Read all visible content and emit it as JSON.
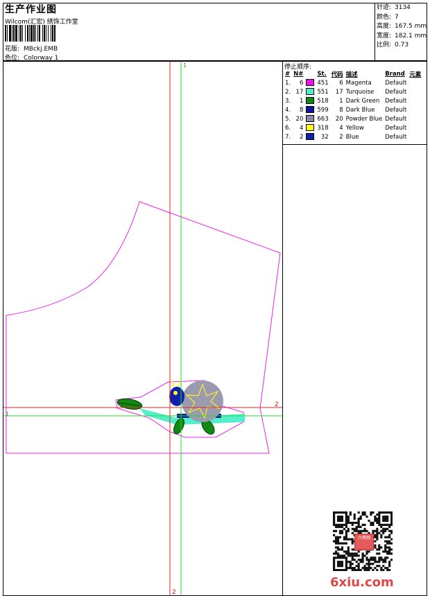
{
  "header": {
    "title": "生产作业图",
    "studio": "Wilcom(汇宏) 绣饰工作室",
    "design_label": "花版:",
    "design_value": "MBckj.EMB",
    "colorway_label": "色位:",
    "colorway_value": "Colorway 1"
  },
  "stats": [
    {
      "label": "针迹:",
      "value": "3134"
    },
    {
      "label": "颜色:",
      "value": "7"
    },
    {
      "label": "高度:",
      "value": "167.5 mm"
    },
    {
      "label": "宽度:",
      "value": "182.1 mm"
    },
    {
      "label": "比例:",
      "value": "0.73"
    }
  ],
  "canvas": {
    "marker_top": "1",
    "marker_left": "1",
    "marker_right": "2",
    "marker_bottom": "2"
  },
  "stop_sequence": {
    "title": "停止顺序:",
    "headers": [
      "#",
      "N#",
      "St.",
      "代码",
      "描述",
      "Brand",
      "元素"
    ],
    "rows": [
      {
        "idx": "1.",
        "n": "6",
        "color": "#ee11ee",
        "st": "451",
        "code": "6",
        "desc": "Magenta",
        "brand": "Default"
      },
      {
        "idx": "2.",
        "n": "17",
        "color": "#55eecc",
        "st": "551",
        "code": "17",
        "desc": "Turquoise",
        "brand": "Default"
      },
      {
        "idx": "3.",
        "n": "1",
        "color": "#118811",
        "st": "518",
        "code": "1",
        "desc": "Dark Green",
        "brand": "Default"
      },
      {
        "idx": "4.",
        "n": "8",
        "color": "#0a1a99",
        "st": "599",
        "code": "8",
        "desc": "Dark Blue",
        "brand": "Default"
      },
      {
        "idx": "5.",
        "n": "20",
        "color": "#8a8aa2",
        "st": "663",
        "code": "20",
        "desc": "Powder Blue",
        "brand": "Default"
      },
      {
        "idx": "6.",
        "n": "4",
        "color": "#ffff22",
        "st": "318",
        "code": "4",
        "desc": "Yellow",
        "brand": "Default"
      },
      {
        "idx": "7.",
        "n": "2",
        "color": "#1122aa",
        "st": "32",
        "code": "2",
        "desc": "Blue",
        "brand": "Default"
      }
    ]
  },
  "watermark": {
    "logo_text": "6xiu.com",
    "seal_text": "六秀网"
  }
}
